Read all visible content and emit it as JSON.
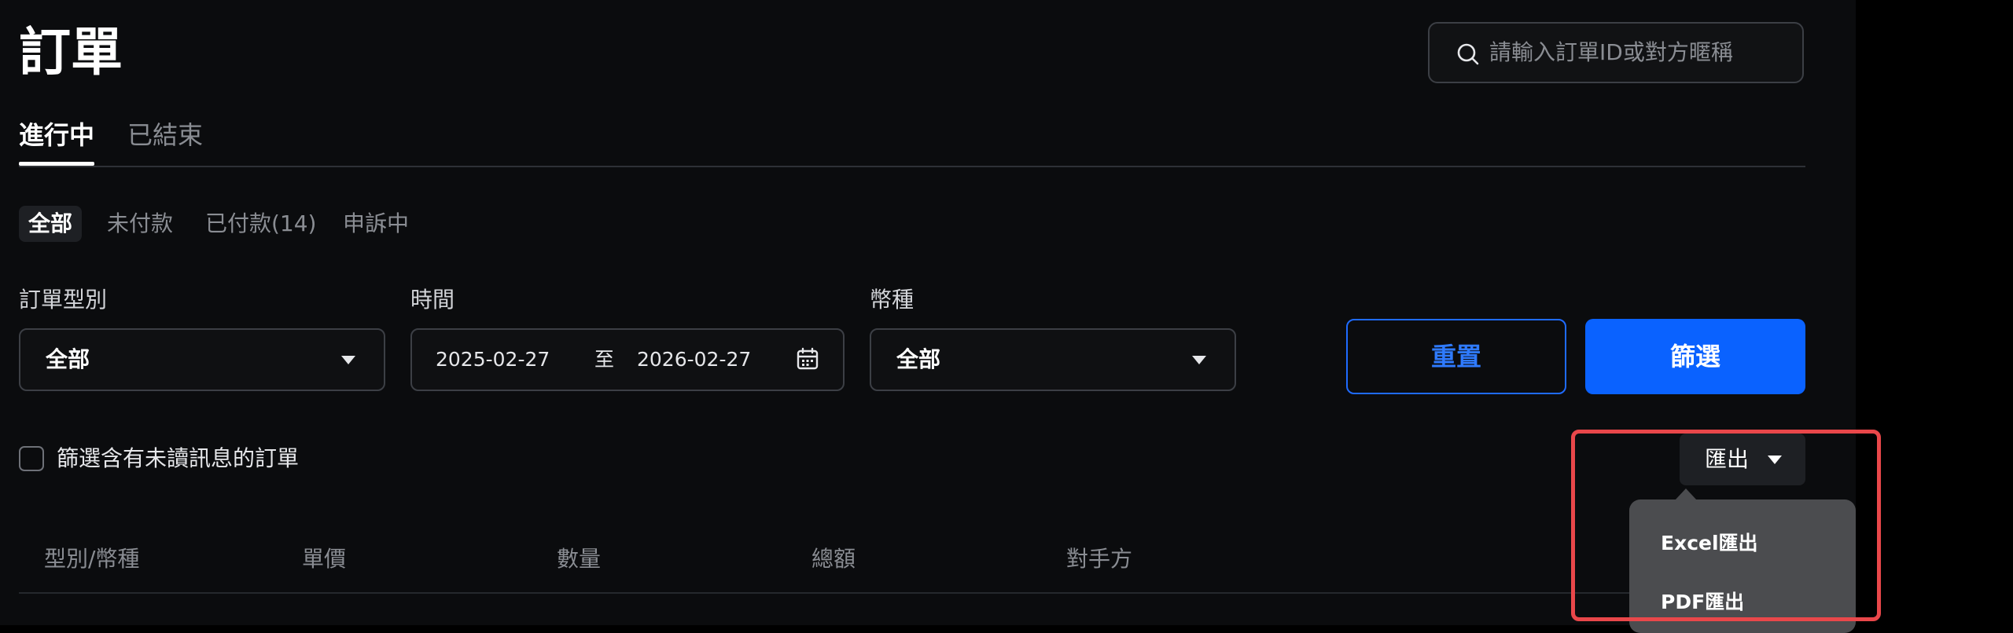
{
  "page": {
    "title": "訂單"
  },
  "search": {
    "placeholder": "請輸入訂單ID或對方暱稱"
  },
  "tabs": [
    {
      "label": "進行中",
      "active": true
    },
    {
      "label": "已結束",
      "active": false
    }
  ],
  "status_filters": [
    {
      "label": "全部",
      "active": true
    },
    {
      "label": "未付款",
      "active": false
    },
    {
      "label": "已付款(14)",
      "active": false
    },
    {
      "label": "申訴中",
      "active": false
    }
  ],
  "filters": {
    "order_type": {
      "label": "訂單型別",
      "value": "全部"
    },
    "time": {
      "label": "時間",
      "start": "2025-02-27",
      "separator": "至",
      "end": "2026-02-27"
    },
    "currency": {
      "label": "幣種",
      "value": "全部"
    }
  },
  "buttons": {
    "reset": "重置",
    "filter": "篩選"
  },
  "unread_filter": {
    "label": "篩選含有未讀訊息的訂單",
    "checked": false
  },
  "export": {
    "label": "匯出",
    "menu": [
      "Excel匯出",
      "PDF匯出"
    ]
  },
  "table": {
    "columns": [
      "型別/幣種",
      "單價",
      "數量",
      "總額",
      "對手方"
    ]
  },
  "colors": {
    "background": "#0b0c0e",
    "accent": "#0a62ff",
    "highlight": "#e9474a"
  }
}
